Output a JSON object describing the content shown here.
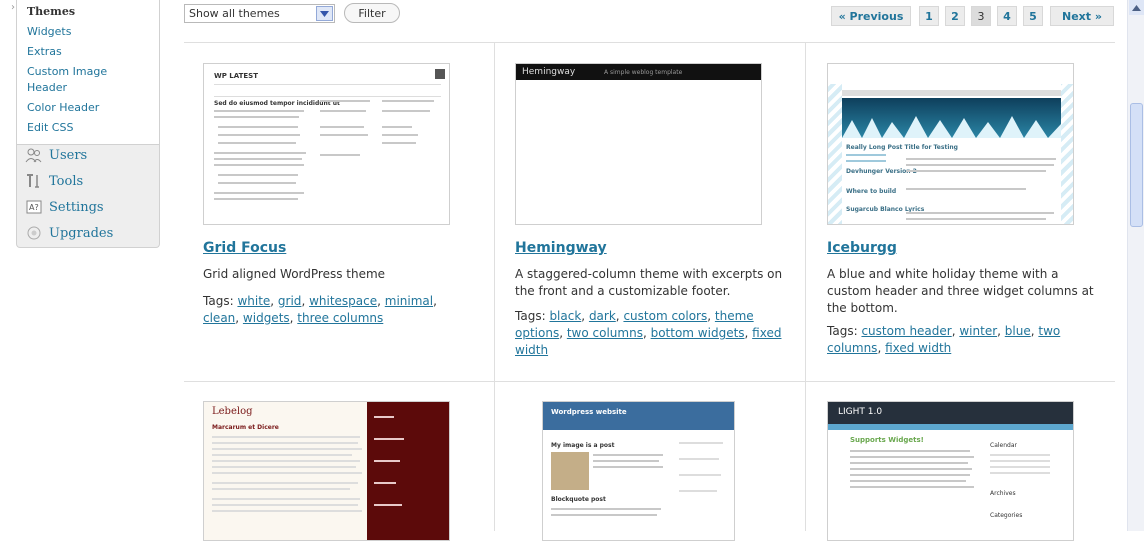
{
  "sidebar": {
    "submenu": [
      {
        "label": "Themes",
        "current": true
      },
      {
        "label": "Widgets"
      },
      {
        "label": "Extras"
      },
      {
        "label": "Custom Image"
      },
      {
        "label": "Header"
      },
      {
        "label": "Color Header"
      },
      {
        "label": "Edit CSS"
      }
    ],
    "menu": [
      {
        "label": "Users",
        "icon": "users-icon"
      },
      {
        "label": "Tools",
        "icon": "tools-icon"
      },
      {
        "label": "Settings",
        "icon": "settings-icon"
      },
      {
        "label": "Upgrades",
        "icon": "upgrades-icon"
      }
    ]
  },
  "filter": {
    "selected": "Show all themes",
    "button": "Filter"
  },
  "pagination": {
    "previous": "« Previous",
    "pages": [
      "1",
      "2",
      "3",
      "4",
      "5"
    ],
    "current": "3",
    "next": "Next »"
  },
  "themes": [
    {
      "name": "Grid Focus",
      "description": "Grid aligned WordPress theme",
      "tags_label": "Tags:",
      "tags": [
        "white",
        "grid",
        "whitespace",
        "minimal",
        "clean",
        "widgets",
        "three columns"
      ],
      "thumb": {
        "header": "WP LATEST",
        "heading": "Sed do eiusmod tempor incididunt ut"
      }
    },
    {
      "name": "Hemingway",
      "description": "A staggered-column theme with excerpts on the front and a customizable footer.",
      "tags_label": "Tags:",
      "tags": [
        "black",
        "dark",
        "custom colors",
        "theme options",
        "two columns",
        "bottom widgets",
        "fixed width"
      ],
      "thumb": {
        "header": "Hemingway",
        "sub": "A simple weblog template"
      }
    },
    {
      "name": "Iceburgg",
      "description": "A blue and white holiday theme with a custom header and three widget columns at the bottom.",
      "tags_label": "Tags:",
      "tags": [
        "custom header",
        "winter",
        "blue",
        "two columns",
        "fixed width"
      ],
      "thumb": {
        "heading1": "Really Long Post Title for Testing",
        "heading2": "Devhunger Version 2",
        "heading3": "Where to build",
        "heading4": "Sugarcub Blanco Lyrics"
      }
    }
  ],
  "row2": [
    {
      "header": "Lebelog",
      "heading": "Marcarum et Dicere"
    },
    {
      "header": "Wordpress website",
      "heading": "My image is a post",
      "heading2": "Blockquote post"
    },
    {
      "header": "LIGHT 1.0",
      "heading": "Supports Widgets!",
      "widget1": "Calendar",
      "widget2": "Categories",
      "widget3": "Archives"
    }
  ],
  "colors": {
    "link": "#21759b",
    "text": "#333333",
    "border": "#dfdfdf"
  }
}
